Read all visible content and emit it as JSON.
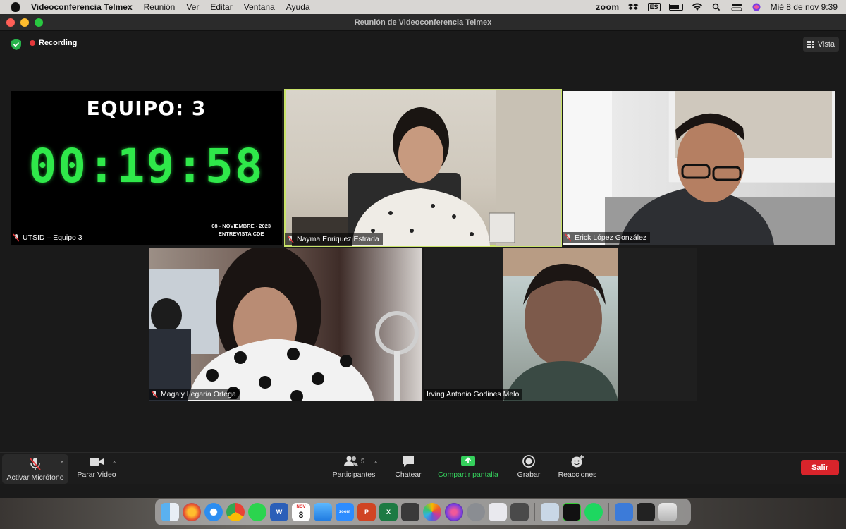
{
  "menubar": {
    "app_name": "Videoconferencia Telmex",
    "menus": [
      "Reunión",
      "Ver",
      "Editar",
      "Ventana",
      "Ayuda"
    ],
    "zoom_label": "zoom",
    "input_source": "ES",
    "datetime": "Mié 8 de nov  9:39"
  },
  "window": {
    "title": "Reunión de Videoconferencia Telmex",
    "recording_label": "Recording",
    "view_label": "Vista"
  },
  "tiles": [
    {
      "name": "UTSID – Equipo 3",
      "muted": true,
      "equipo_text": "EQUIPO: 3",
      "timer": "00:19:58",
      "date_line1": "08 - NOVIEMBRE - 2023",
      "date_line2": "ENTREVISTA CDE"
    },
    {
      "name": "Nayma Enriquez Estrada",
      "muted": true,
      "active_speaker": true
    },
    {
      "name": "Erick López González",
      "muted": true
    },
    {
      "name": "Magaly Legaria Ortega",
      "muted": true
    },
    {
      "name": "Irving Antonio Godines Melo",
      "muted": false
    }
  ],
  "toolbar": {
    "mic_label": "Activar Micrófono",
    "video_label": "Parar Video",
    "participants_label": "Participantes",
    "participants_count": "5",
    "chat_label": "Chatear",
    "share_label": "Compartir pantalla",
    "record_label": "Grabar",
    "reactions_label": "Reacciones",
    "leave_label": "Salir"
  },
  "dock": {
    "calendar_month": "NOV",
    "calendar_day": "8",
    "apps": [
      "finder-icon",
      "firefox-icon",
      "safari-icon",
      "chrome-icon",
      "whatsapp-icon",
      "word-icon",
      "calendar-icon",
      "mail-icon",
      "zoom-icon",
      "powerpoint-icon",
      "excel-icon",
      "calculator-icon",
      "photos-icon",
      "siri-icon",
      "settings-icon",
      "launchpad-icon",
      "facetime-icon",
      "preview-icon",
      "activity-monitor-icon",
      "spotify-icon",
      "downloads-icon",
      "screenshot-icon",
      "trash-icon"
    ]
  },
  "colors": {
    "accent_green": "#35d05c",
    "leave_red": "#d9242b",
    "active_border": "#c9e36a",
    "timer_green": "#2fe84a"
  }
}
